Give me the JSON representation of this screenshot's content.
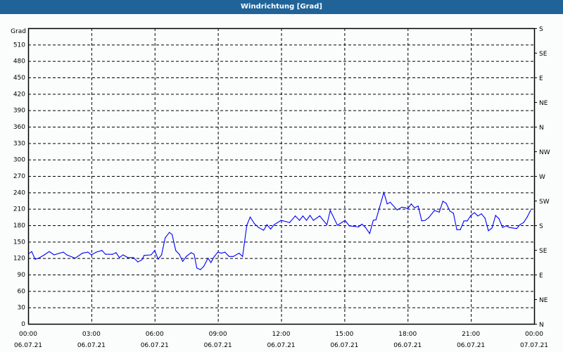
{
  "window": {
    "title": "Windrichtung [Grad]"
  },
  "chart_data": {
    "type": "line",
    "title": "Windrichtung [Grad]",
    "ylabel": "Grad",
    "ylim": [
      0,
      540
    ],
    "xlim_hours": [
      0,
      24
    ],
    "grid": true,
    "y_ticks": [
      0,
      30,
      60,
      90,
      120,
      150,
      180,
      210,
      240,
      270,
      300,
      330,
      360,
      390,
      420,
      450,
      480,
      510
    ],
    "right_axis": [
      {
        "value": 0,
        "label": "N"
      },
      {
        "value": 45,
        "label": "NE"
      },
      {
        "value": 90,
        "label": "E"
      },
      {
        "value": 135,
        "label": "SE"
      },
      {
        "value": 180,
        "label": "S"
      },
      {
        "value": 225,
        "label": "SW"
      },
      {
        "value": 270,
        "label": "W"
      },
      {
        "value": 315,
        "label": "NW"
      },
      {
        "value": 360,
        "label": "N"
      },
      {
        "value": 405,
        "label": "NE"
      },
      {
        "value": 450,
        "label": "E"
      },
      {
        "value": 495,
        "label": "SE"
      },
      {
        "value": 540,
        "label": "S"
      }
    ],
    "x_ticks": [
      {
        "hour": 0,
        "time": "00:00",
        "date": "06.07.21"
      },
      {
        "hour": 3,
        "time": "03:00",
        "date": "06.07.21"
      },
      {
        "hour": 6,
        "time": "06:00",
        "date": "06.07.21"
      },
      {
        "hour": 9,
        "time": "09:00",
        "date": "06.07.21"
      },
      {
        "hour": 12,
        "time": "12:00",
        "date": "06.07.21"
      },
      {
        "hour": 15,
        "time": "15:00",
        "date": "06.07.21"
      },
      {
        "hour": 18,
        "time": "18:00",
        "date": "06.07.21"
      },
      {
        "hour": 21,
        "time": "21:00",
        "date": "06.07.21"
      },
      {
        "hour": 24,
        "time": "00:00",
        "date": "07.07.21"
      }
    ],
    "series": [
      {
        "name": "Windrichtung",
        "color": "#0000ff",
        "x": [
          0.06,
          0.17,
          0.33,
          0.5,
          0.77,
          1.0,
          1.23,
          1.67,
          1.83,
          2.23,
          2.57,
          2.83,
          3.0,
          3.23,
          3.5,
          3.67,
          4.0,
          4.17,
          4.33,
          4.5,
          4.73,
          5.0,
          5.2,
          5.4,
          5.5,
          5.83,
          6.0,
          6.17,
          6.33,
          6.5,
          6.7,
          6.83,
          7.0,
          7.17,
          7.33,
          7.5,
          7.73,
          7.87,
          8.0,
          8.17,
          8.33,
          8.53,
          8.67,
          8.83,
          9.0,
          9.17,
          9.33,
          9.53,
          9.73,
          10.0,
          10.17,
          10.37,
          10.53,
          10.73,
          10.93,
          11.17,
          11.33,
          11.5,
          11.67,
          12.0,
          12.4,
          12.67,
          12.87,
          13.03,
          13.2,
          13.37,
          13.53,
          13.83,
          14.17,
          14.33,
          14.67,
          15.03,
          15.23,
          15.67,
          15.83,
          16.0,
          16.2,
          16.37,
          16.5,
          16.67,
          16.87,
          17.03,
          17.17,
          17.5,
          17.73,
          17.9,
          18.0,
          18.17,
          18.33,
          18.5,
          18.67,
          18.83,
          19.0,
          19.27,
          19.5,
          19.67,
          19.83,
          20.0,
          20.17,
          20.33,
          20.5,
          20.67,
          20.83,
          21.0,
          21.17,
          21.33,
          21.5,
          21.67,
          21.83,
          22.0,
          22.17,
          22.33,
          22.5,
          22.67,
          22.83,
          23.0,
          23.17,
          23.33,
          23.5,
          23.67,
          23.83
        ],
        "values": [
          129,
          132,
          118,
          120,
          126,
          132,
          126,
          131,
          126,
          120,
          129,
          131,
          126,
          131,
          134,
          127,
          127,
          130,
          121,
          126,
          121,
          121,
          113,
          117,
          125,
          126,
          134,
          118,
          126,
          157,
          167,
          163,
          134,
          127,
          114,
          123,
          130,
          127,
          102,
          99,
          105,
          120,
          112,
          123,
          131,
          129,
          131,
          123,
          123,
          129,
          123,
          180,
          195,
          183,
          176,
          171,
          181,
          173,
          181,
          189,
          185,
          197,
          189,
          197,
          189,
          198,
          189,
          197,
          181,
          207,
          180,
          189,
          179,
          177,
          182,
          176,
          165,
          189,
          190,
          213,
          240,
          219,
          222,
          208,
          213,
          212,
          210,
          219,
          212,
          215,
          188,
          189,
          194,
          207,
          204,
          224,
          220,
          206,
          202,
          172,
          172,
          188,
          188,
          198,
          203,
          197,
          201,
          193,
          170,
          175,
          198,
          192,
          176,
          179,
          176,
          175,
          174,
          181,
          185,
          195,
          207
        ]
      }
    ]
  }
}
